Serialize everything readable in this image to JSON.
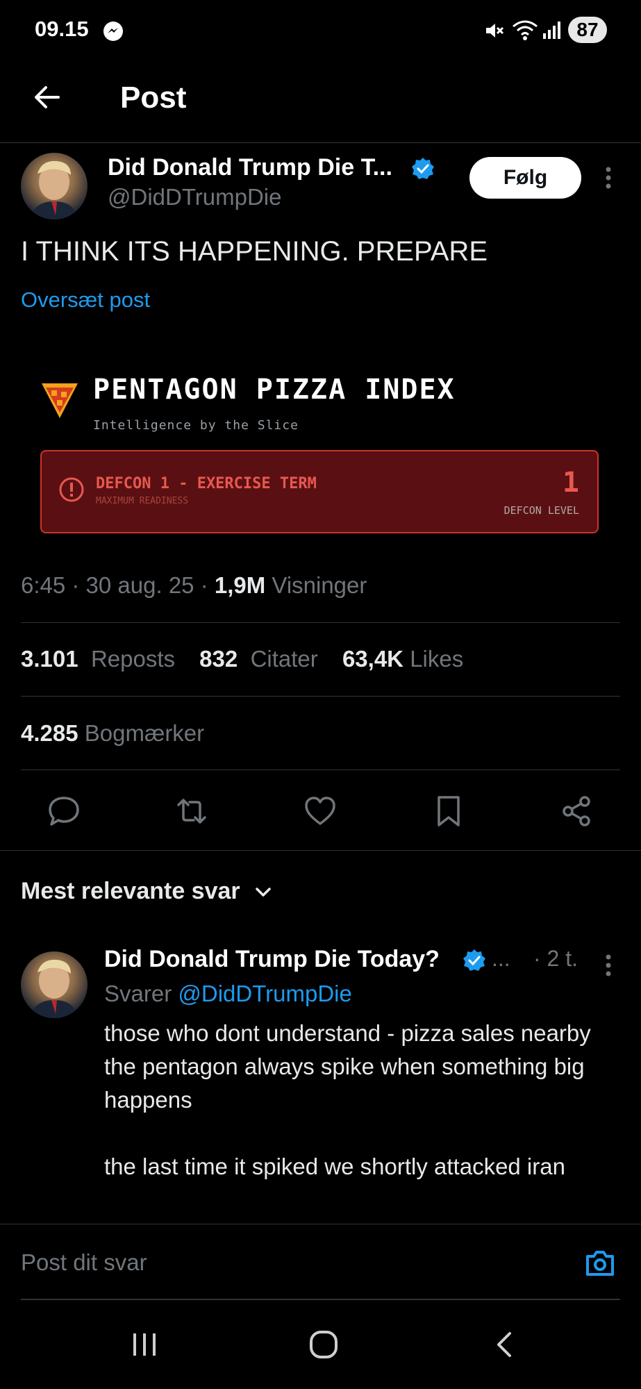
{
  "status_bar": {
    "time": "09.15",
    "battery": "87",
    "icons": [
      "messenger-icon",
      "mute-icon",
      "wifi-icon",
      "signal-icon"
    ]
  },
  "header": {
    "title": "Post",
    "back_icon": "arrow-left-icon"
  },
  "post": {
    "author_name": "Did Donald Trump Die T...",
    "author_handle": "@DidDTrumpDie",
    "follow_label": "Følg",
    "text": "I THINK ITS HAPPENING. PREPARE",
    "translate_label": "Oversæt post",
    "card": {
      "title": "PENTAGON PIZZA INDEX",
      "subtitle": "Intelligence by the Slice",
      "alert_title": "DEFCON 1 - EXERCISE TERM",
      "alert_subtitle": "MAXIMUM READINESS",
      "level_value": "1",
      "level_label": "DEFCON LEVEL"
    },
    "meta": {
      "time_date": "6:45 · 30 aug. 25 · ",
      "views_count": "1,9M",
      "views_label": " Visninger"
    },
    "stats": {
      "reposts_count": "3.101",
      "reposts_label": "Reposts",
      "quotes_count": "832",
      "quotes_label": "Citater",
      "likes_count": "63,4K",
      "likes_label": "Likes",
      "bookmarks_count": "4.285",
      "bookmarks_label": "Bogmærker"
    },
    "actions": [
      "reply-icon",
      "repost-icon",
      "like-icon",
      "bookmark-icon",
      "share-icon"
    ]
  },
  "replies": {
    "sort_label": "Mest relevante svar",
    "items": [
      {
        "author_name": "Did Donald Trump Die Today?",
        "ellipsis": "...",
        "time": "· 2 t.",
        "replying_prefix": "Svarer ",
        "replying_handle": "@DidDTrumpDie",
        "text": "those who dont understand - pizza sales nearby the pentagon always spike when something big happens\n\nthe last time it spiked we shortly attacked iran"
      }
    ]
  },
  "composer": {
    "placeholder": "Post dit svar"
  },
  "colors": {
    "background": "#000000",
    "accent": "#1d9bf0",
    "secondary_text": "#71767b",
    "alert_red": "#e8584f"
  }
}
